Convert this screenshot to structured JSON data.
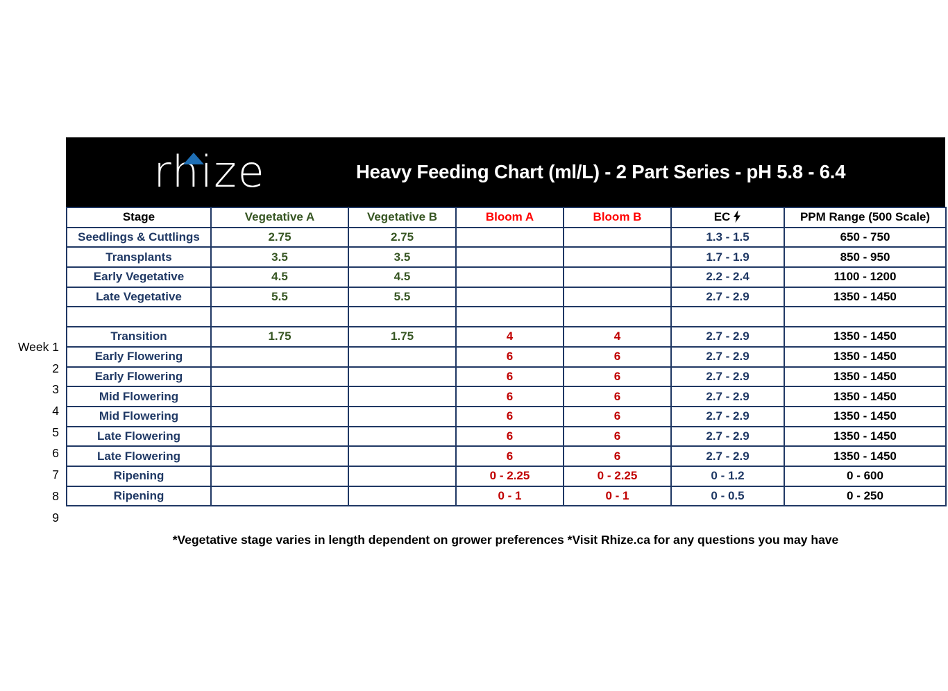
{
  "banner": {
    "logo_text": "rhize",
    "logo_caret_icon": "chevron-up-accent",
    "title": "Heavy Feeding Chart (ml/L) - 2 Part Series - pH 5.8 - 6.4",
    "background_color": "#000000",
    "accent_color": "#1F6FB5"
  },
  "table": {
    "headers": {
      "stage": "Stage",
      "vegetative_a": "Vegetative A",
      "vegetative_b": "Vegetative B",
      "bloom_a": "Bloom A",
      "bloom_b": "Bloom B",
      "ec": "EC",
      "ec_icon": "lightning-bolt-icon",
      "ec_icon_glyph": "⚡",
      "ppm": "PPM Range (500 Scale)"
    },
    "week_label": "Week 1",
    "week_numbers": [
      "2",
      "3",
      "4",
      "5",
      "6",
      "7",
      "8",
      "9"
    ],
    "rows": [
      {
        "week": "",
        "stage": "Seedlings & Cuttlings",
        "veg_a": "2.75",
        "veg_b": "2.75",
        "bloom_a": "",
        "bloom_b": "",
        "ec": "1.3 - 1.5",
        "ppm": "650 - 750"
      },
      {
        "week": "",
        "stage": "Transplants",
        "veg_a": "3.5",
        "veg_b": "3.5",
        "bloom_a": "",
        "bloom_b": "",
        "ec": "1.7 - 1.9",
        "ppm": "850 - 950"
      },
      {
        "week": "",
        "stage": "Early Vegetative",
        "veg_a": "4.5",
        "veg_b": "4.5",
        "bloom_a": "",
        "bloom_b": "",
        "ec": "2.2 - 2.4",
        "ppm": "1100 - 1200"
      },
      {
        "week": "",
        "stage": "Late Vegetative",
        "veg_a": "5.5",
        "veg_b": "5.5",
        "bloom_a": "",
        "bloom_b": "",
        "ec": "2.7 - 2.9",
        "ppm": "1350 - 1450"
      },
      {
        "week": "",
        "stage": "",
        "veg_a": "",
        "veg_b": "",
        "bloom_a": "",
        "bloom_b": "",
        "ec": "",
        "ppm": ""
      },
      {
        "week": "Week 1",
        "stage": "Transition",
        "veg_a": "1.75",
        "veg_b": "1.75",
        "bloom_a": "4",
        "bloom_b": "4",
        "ec": "2.7 - 2.9",
        "ppm": "1350 - 1450"
      },
      {
        "week": "2",
        "stage": "Early Flowering",
        "veg_a": "",
        "veg_b": "",
        "bloom_a": "6",
        "bloom_b": "6",
        "ec": "2.7 - 2.9",
        "ppm": "1350 - 1450"
      },
      {
        "week": "3",
        "stage": "Early Flowering",
        "veg_a": "",
        "veg_b": "",
        "bloom_a": "6",
        "bloom_b": "6",
        "ec": "2.7 - 2.9",
        "ppm": "1350 - 1450"
      },
      {
        "week": "4",
        "stage": "Mid Flowering",
        "veg_a": "",
        "veg_b": "",
        "bloom_a": "6",
        "bloom_b": "6",
        "ec": "2.7 - 2.9",
        "ppm": "1350 - 1450"
      },
      {
        "week": "5",
        "stage": "Mid Flowering",
        "veg_a": "",
        "veg_b": "",
        "bloom_a": "6",
        "bloom_b": "6",
        "ec": "2.7 - 2.9",
        "ppm": "1350 - 1450"
      },
      {
        "week": "6",
        "stage": "Late Flowering",
        "veg_a": "",
        "veg_b": "",
        "bloom_a": "6",
        "bloom_b": "6",
        "ec": "2.7 - 2.9",
        "ppm": "1350 - 1450"
      },
      {
        "week": "7",
        "stage": "Late Flowering",
        "veg_a": "",
        "veg_b": "",
        "bloom_a": "6",
        "bloom_b": "6",
        "ec": "2.7 - 2.9",
        "ppm": "1350 - 1450"
      },
      {
        "week": "8",
        "stage": "Ripening",
        "veg_a": "",
        "veg_b": "",
        "bloom_a": "0 - 2.25",
        "bloom_b": "0 - 2.25",
        "ec": "0 - 1.2",
        "ppm": "0 - 600"
      },
      {
        "week": "9",
        "stage": "Ripening",
        "veg_a": "",
        "veg_b": "",
        "bloom_a": "0 - 1",
        "bloom_b": "0 - 1",
        "ec": "0 - 0.5",
        "ppm": "0 - 250"
      }
    ]
  },
  "footnote": "*Vegetative stage varies in length dependent on grower preferences *Visit Rhize.ca for any questions you may have",
  "colors": {
    "border": "#203864",
    "green_fill": "#A9D08E",
    "green_text": "#375623",
    "pink_fill": "#F8CBCB",
    "red_text": "#C00000",
    "header_red": "#FF0000",
    "navy_text": "#1F3864"
  }
}
